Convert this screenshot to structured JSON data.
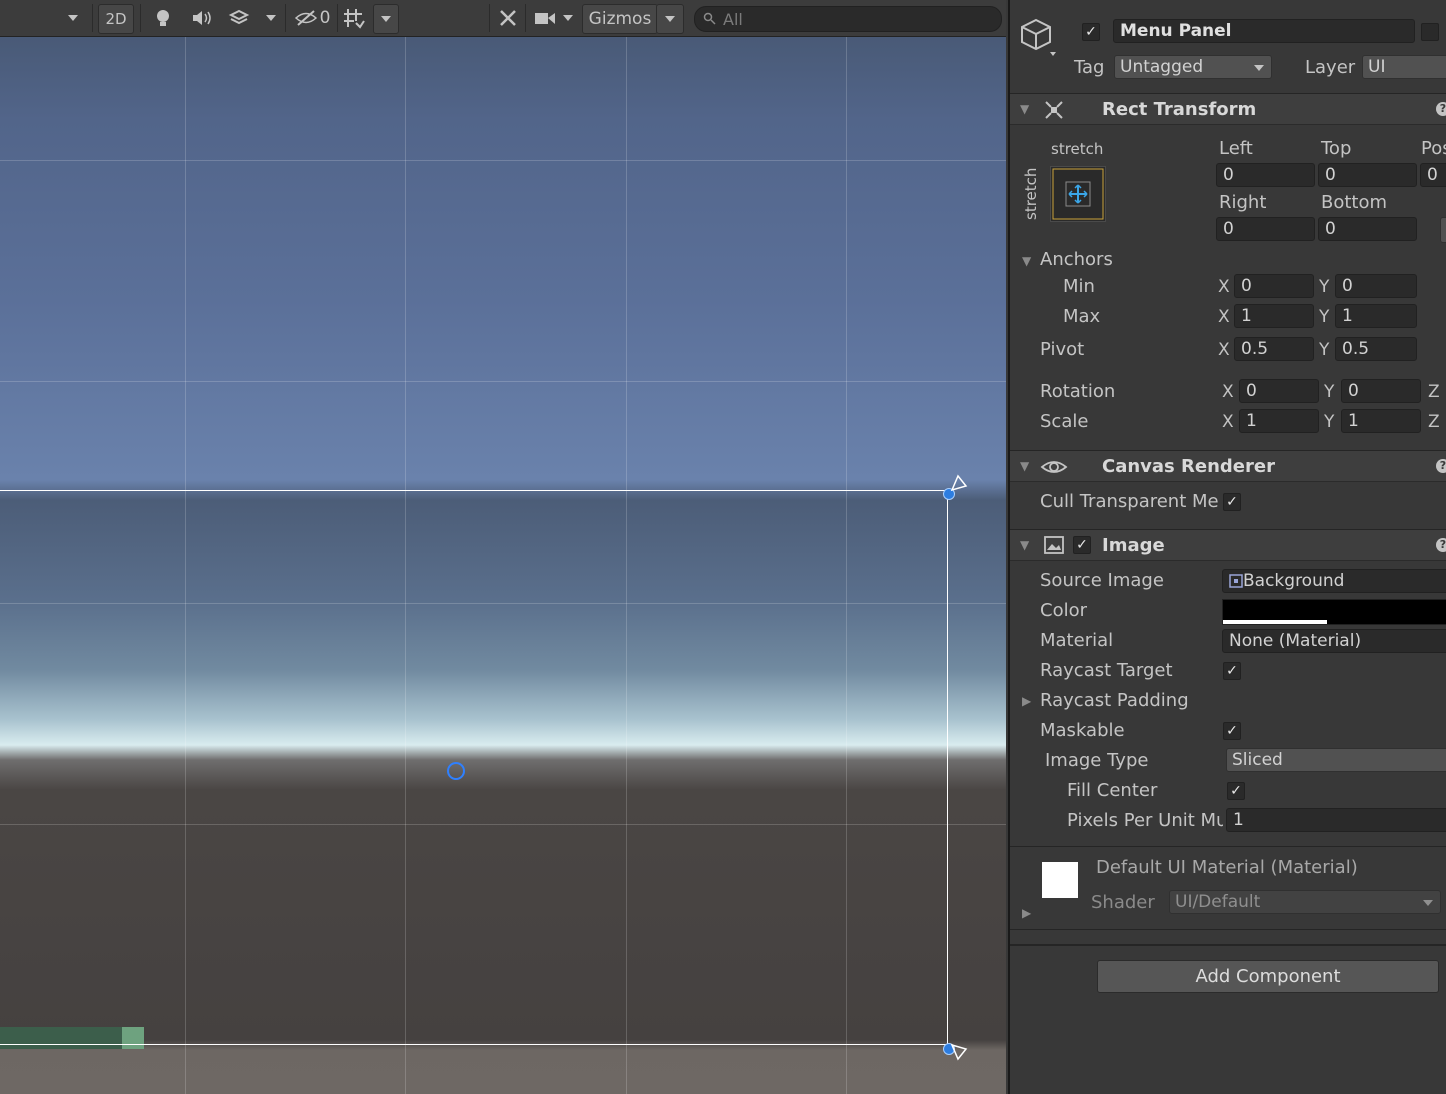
{
  "toolbar": {
    "mode_2d": "2D",
    "hidden_count": "0",
    "gizmos": "Gizmos",
    "search_placeholder": "All"
  },
  "inspector": {
    "object_name": "Menu Panel",
    "tag_label": "Tag",
    "tag_value": "Untagged",
    "layer_label": "Layer",
    "layer_value": "UI",
    "rect_transform": {
      "title": "Rect Transform",
      "anchor_preset_h": "stretch",
      "anchor_preset_v": "stretch",
      "left_label": "Left",
      "left": "0",
      "top_label": "Top",
      "top": "0",
      "posz_label": "Pos",
      "posz": "0",
      "right_label": "Right",
      "right": "0",
      "bottom_label": "Bottom",
      "bottom": "0",
      "anchors_label": "Anchors",
      "min_label": "Min",
      "min_x": "0",
      "min_y": "0",
      "max_label": "Max",
      "max_x": "1",
      "max_y": "1",
      "pivot_label": "Pivot",
      "pivot_x": "0.5",
      "pivot_y": "0.5",
      "rotation_label": "Rotation",
      "rot_x": "0",
      "rot_y": "0",
      "scale_label": "Scale",
      "scale_x": "1",
      "scale_y": "1",
      "x": "X",
      "y": "Y",
      "z": "Z"
    },
    "canvas_renderer": {
      "title": "Canvas Renderer",
      "cull_label": "Cull Transparent Me"
    },
    "image": {
      "title": "Image",
      "source_image_label": "Source Image",
      "source_image_value": "Background",
      "color_label": "Color",
      "material_label": "Material",
      "material_value": "None (Material)",
      "raycast_target_label": "Raycast Target",
      "raycast_padding_label": "Raycast Padding",
      "maskable_label": "Maskable",
      "image_type_label": "Image Type",
      "image_type_value": "Sliced",
      "fill_center_label": "Fill Center",
      "ppu_label": "Pixels Per Unit Mu",
      "ppu_value": "1"
    },
    "material_preview": {
      "name": "Default UI Material (Material)",
      "shader_label": "Shader",
      "shader_value": "UI/Default"
    },
    "add_component": "Add Component"
  },
  "colors": {
    "selection_handle": "#2d7de0",
    "image_color": "#000000"
  }
}
